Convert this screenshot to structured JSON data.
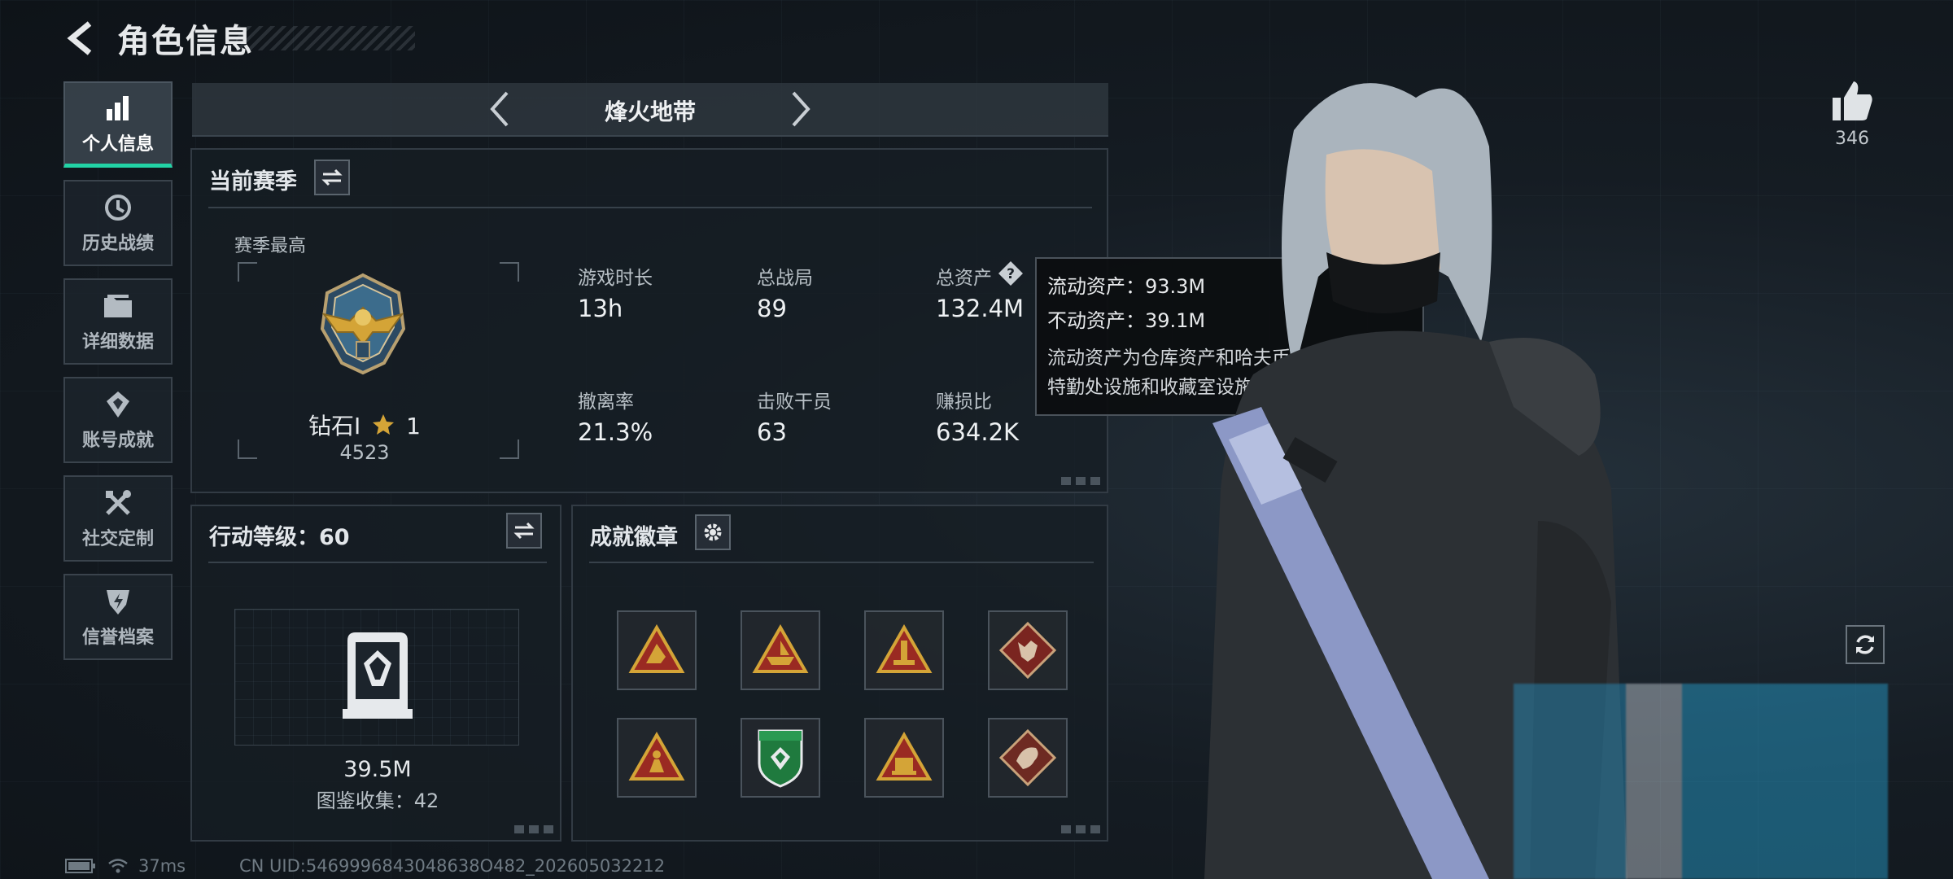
{
  "header": {
    "title": "角色信息"
  },
  "sidebar": {
    "items": [
      {
        "label": "个人信息",
        "icon": "bar-chart-icon",
        "active": true
      },
      {
        "label": "历史战绩",
        "icon": "history-clock-icon"
      },
      {
        "label": "详细数据",
        "icon": "folder-icon"
      },
      {
        "label": "账号成就",
        "icon": "achievement-icon"
      },
      {
        "label": "社交定制",
        "icon": "tools-icon"
      },
      {
        "label": "信誉档案",
        "icon": "shield-lightning-icon"
      }
    ]
  },
  "mode": {
    "label": "烽火地带"
  },
  "season": {
    "title": "当前赛季",
    "best_label": "赛季最高",
    "rank_name": "钻石I",
    "rank_star": "1",
    "rank_score": "4523",
    "stats": [
      {
        "label": "游戏时长",
        "value": "13h"
      },
      {
        "label": "总战局",
        "value": "89"
      },
      {
        "label": "总资产",
        "value": "132.4M"
      },
      {
        "label": "撤离率",
        "value": "21.3%"
      },
      {
        "label": "击败干员",
        "value": "63"
      },
      {
        "label": "赚损比",
        "value": "634.2K"
      }
    ]
  },
  "tooltip": {
    "line1": "流动资产：93.3M",
    "line2": "不动资产：39.1M",
    "desc": "流动资产为仓库资产和哈夫币，不动资产为特勤处设施和收藏室设施"
  },
  "action_level": {
    "title": "行动等级：60",
    "value": "39.5M",
    "collection": "图鉴收集：42"
  },
  "achievements": {
    "title": "成就徽章",
    "badges": [
      {
        "icon": "soldier-triangle-badge-icon",
        "color": "#c0392b"
      },
      {
        "icon": "boat-triangle-badge-icon",
        "color": "#c0392b"
      },
      {
        "icon": "tower-triangle-badge-icon",
        "color": "#c0392b"
      },
      {
        "icon": "wolf-diamond-badge-icon",
        "color": "#8a2a24"
      },
      {
        "icon": "figure-triangle-badge-icon",
        "color": "#c0392b"
      },
      {
        "icon": "shield-green-badge-icon",
        "color": "#1f7a3e"
      },
      {
        "icon": "number-triangle-badge-icon",
        "color": "#c0392b"
      },
      {
        "icon": "dragon-diamond-badge-icon",
        "color": "#8a2a24"
      }
    ]
  },
  "likes": {
    "count": "346"
  },
  "footer": {
    "ping": "37ms",
    "uid": "CN UID:5469996843048638O482_202605032212"
  },
  "colors": {
    "accent": "#22d3a6",
    "gold": "#d4a437"
  }
}
